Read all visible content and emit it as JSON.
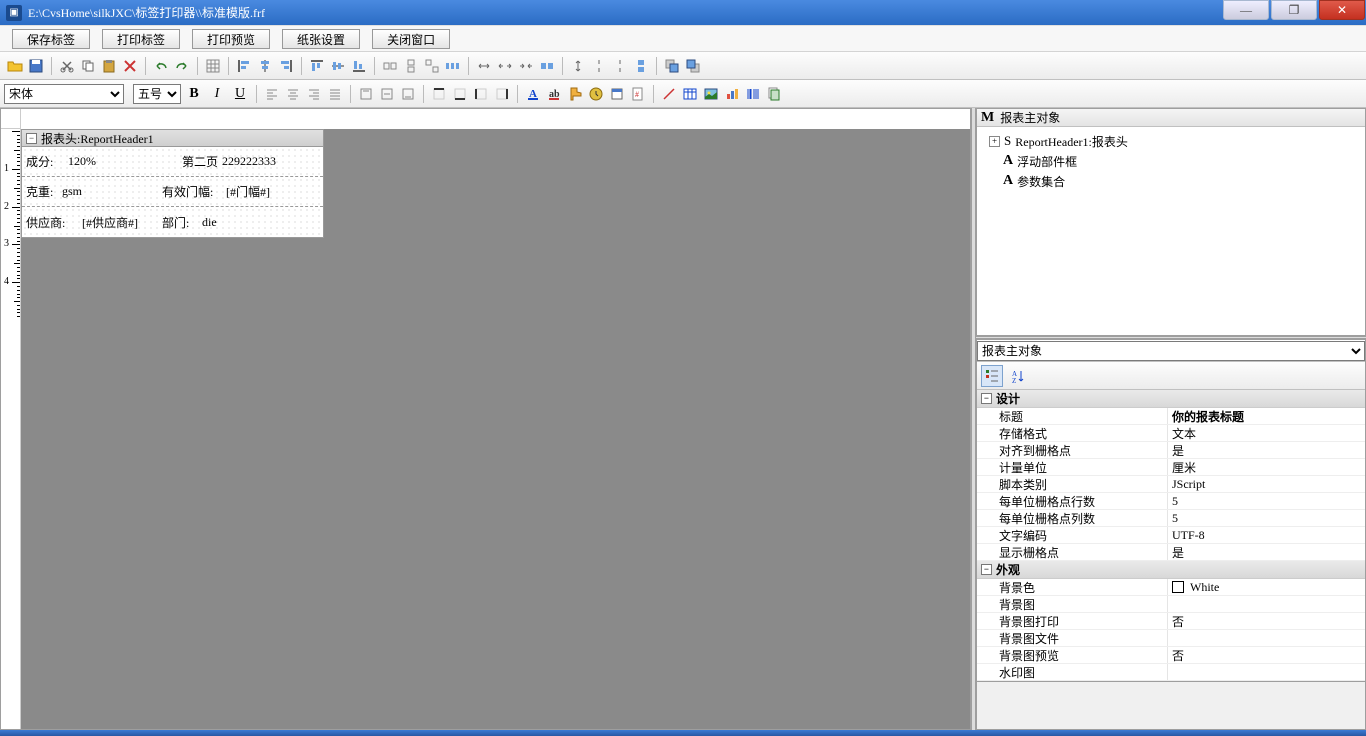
{
  "title": "E:\\CvsHome\\silkJXC\\标签打印器\\\\标准模版.frf",
  "buttons": {
    "save": "保存标签",
    "print": "打印标签",
    "preview": "打印预览",
    "page": "纸张设置",
    "close": "关闭窗口"
  },
  "font": {
    "name": "宋体",
    "size": "五号"
  },
  "section": {
    "header": "报表头:ReportHeader1",
    "fields": {
      "comp_label": "成分:",
      "comp_val": "120%",
      "page2_label": "第二页",
      "page2_val": "229222333",
      "weight_label": "克重:",
      "weight_val": "gsm",
      "width_label": "有效门幅:",
      "width_val": "[#门幅#]",
      "supplier_label": "供应商:",
      "supplier_val": "[#供应商#]",
      "dept_label": "部门:",
      "dept_val": "die"
    }
  },
  "objTree": {
    "title": "报表主对象",
    "items": {
      "r1": "ReportHeader1:报表头",
      "r2": "浮动部件框",
      "r3": "参数集合"
    }
  },
  "propSelector": "报表主对象",
  "propCats": {
    "design": "设计",
    "appearance": "外观"
  },
  "props": {
    "title_k": "标题",
    "title_v": "你的报表标题",
    "storage_k": "存储格式",
    "storage_v": "文本",
    "snap_k": "对齐到栅格点",
    "snap_v": "是",
    "unit_k": "计量单位",
    "unit_v": "厘米",
    "script_k": "脚本类别",
    "script_v": "JScript",
    "rows_k": "每单位栅格点行数",
    "rows_v": "5",
    "cols_k": "每单位栅格点列数",
    "cols_v": "5",
    "enc_k": "文字编码",
    "enc_v": "UTF-8",
    "show_k": "显示栅格点",
    "show_v": "是",
    "bgcolor_k": "背景色",
    "bgcolor_v": "White",
    "bgimg_k": "背景图",
    "bgimg_v": "",
    "bgprint_k": "背景图打印",
    "bgprint_v": "否",
    "bgfile_k": "背景图文件",
    "bgfile_v": "",
    "bgpreview_k": "背景图预览",
    "bgpreview_v": "否",
    "watermark_k": "水印图",
    "watermark_v": ""
  }
}
